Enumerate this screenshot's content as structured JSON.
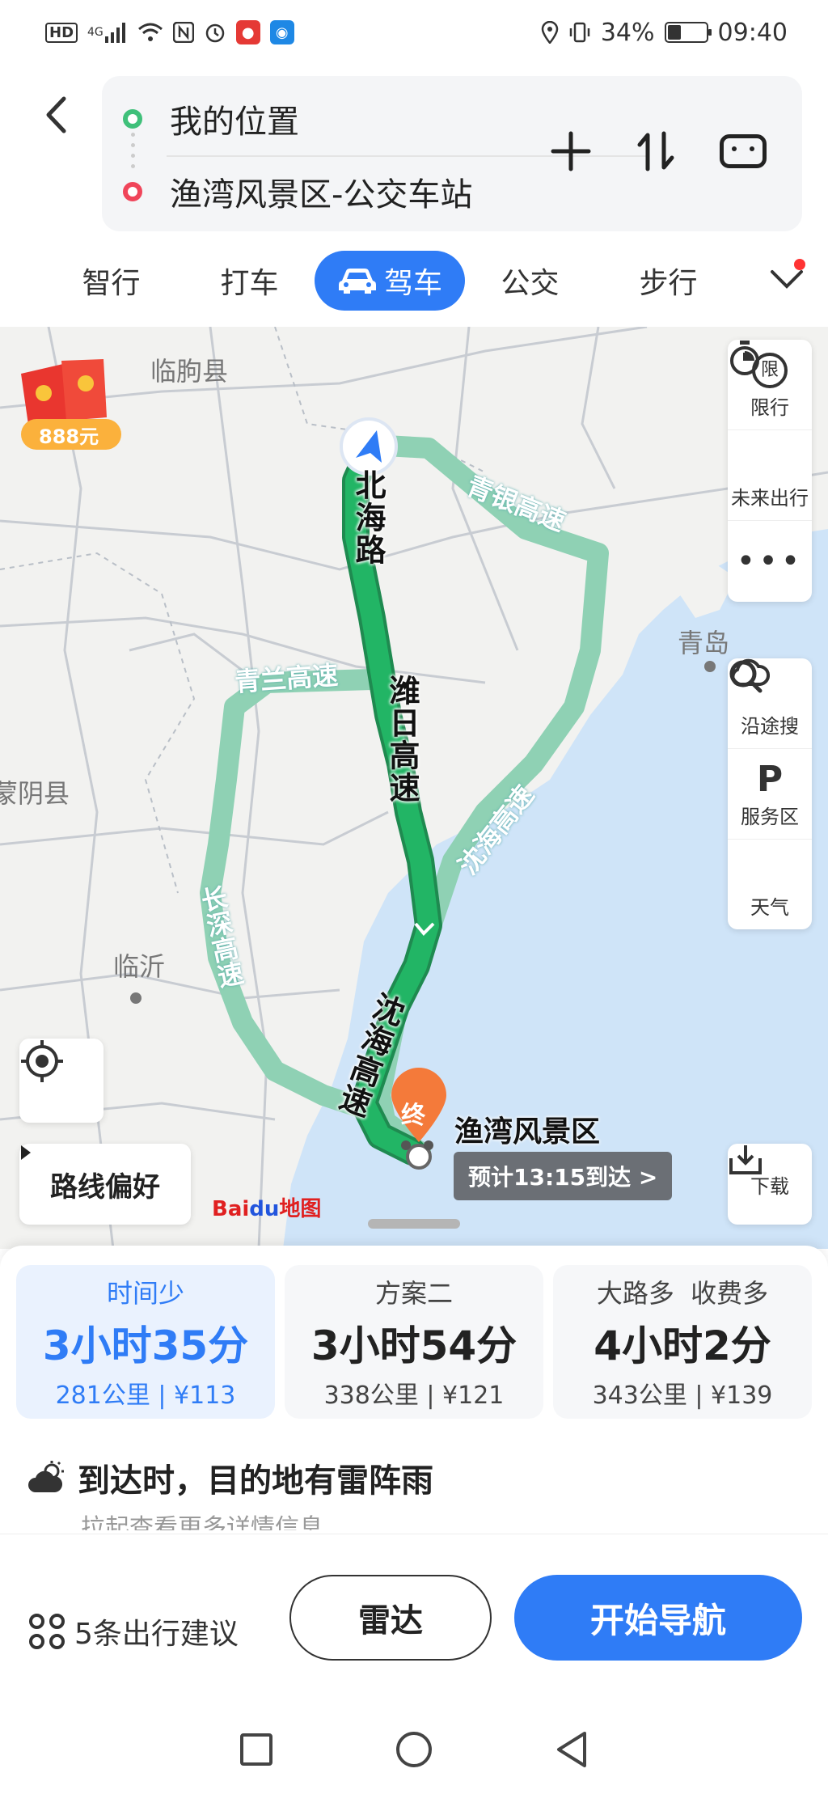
{
  "status_bar": {
    "left_icons": [
      "HD",
      "4G",
      "signal-icon",
      "wifi-icon",
      "nfc-icon",
      "alarm-icon",
      "mic-icon",
      "bulb-icon"
    ],
    "battery_percent": "34%",
    "battery_level": 0.34,
    "time": "09:40"
  },
  "route": {
    "start": "我的位置",
    "end": "渔湾风景区-公交车站"
  },
  "tabs": [
    {
      "label": "智行"
    },
    {
      "label": "打车"
    },
    {
      "label": "驾车",
      "active": true
    },
    {
      "label": "公交"
    },
    {
      "label": "步行"
    }
  ],
  "map": {
    "places": {
      "linqu": "临朐县",
      "qingdao": "青岛",
      "mengyin": "蒙阴县",
      "linyi": "临沂"
    },
    "roads": {
      "qingyin": "青银高速",
      "qinglan": "青兰高速",
      "shenhai1": "沈海高速",
      "changshen": "长深高速",
      "beihai": "北海路",
      "weiri": "潍日高速",
      "shenhai2": "沈海高速"
    },
    "red_envelope_amount": "888元",
    "destination_marker": "终",
    "destination_name": "渔湾风景区",
    "eta": "预计13:15到达 >",
    "side_tools": [
      {
        "icon": "restriction-icon",
        "label": "限行",
        "icon_text": "限"
      },
      {
        "icon": "timer-icon",
        "label": "未来出行"
      },
      {
        "icon": "more-icon",
        "label": ""
      }
    ],
    "side_tools2": [
      {
        "icon": "search-icon",
        "label": "沿途搜"
      },
      {
        "icon": "parking-icon",
        "label": "服务区"
      },
      {
        "icon": "cloud-icon",
        "label": "天气"
      }
    ],
    "route_pref_label": "路线偏好",
    "download_label": "下载",
    "logo": {
      "bai": "Bai",
      "du": "du",
      "map": "地图"
    }
  },
  "plans": [
    {
      "name": "时间少",
      "duration": "3小时35分",
      "distance": "281公里",
      "toll": "¥113"
    },
    {
      "name": "方案二",
      "duration": "3小时54分",
      "distance": "338公里",
      "toll": "¥121"
    },
    {
      "name": "大路多  收费多",
      "duration": "4小时2分",
      "distance": "343公里",
      "toll": "¥139"
    }
  ],
  "weather": {
    "message": "到达时，目的地有雷阵雨",
    "sub": "拉起查看更多详情信息"
  },
  "actions": {
    "suggestions": "5条出行建议",
    "radar": "雷达",
    "start_nav": "开始导航"
  },
  "colors": {
    "accent": "#2f7cf6",
    "route_main": "#22b565",
    "route_alt": "#8fd1b4",
    "water": "#cfe4f8"
  }
}
